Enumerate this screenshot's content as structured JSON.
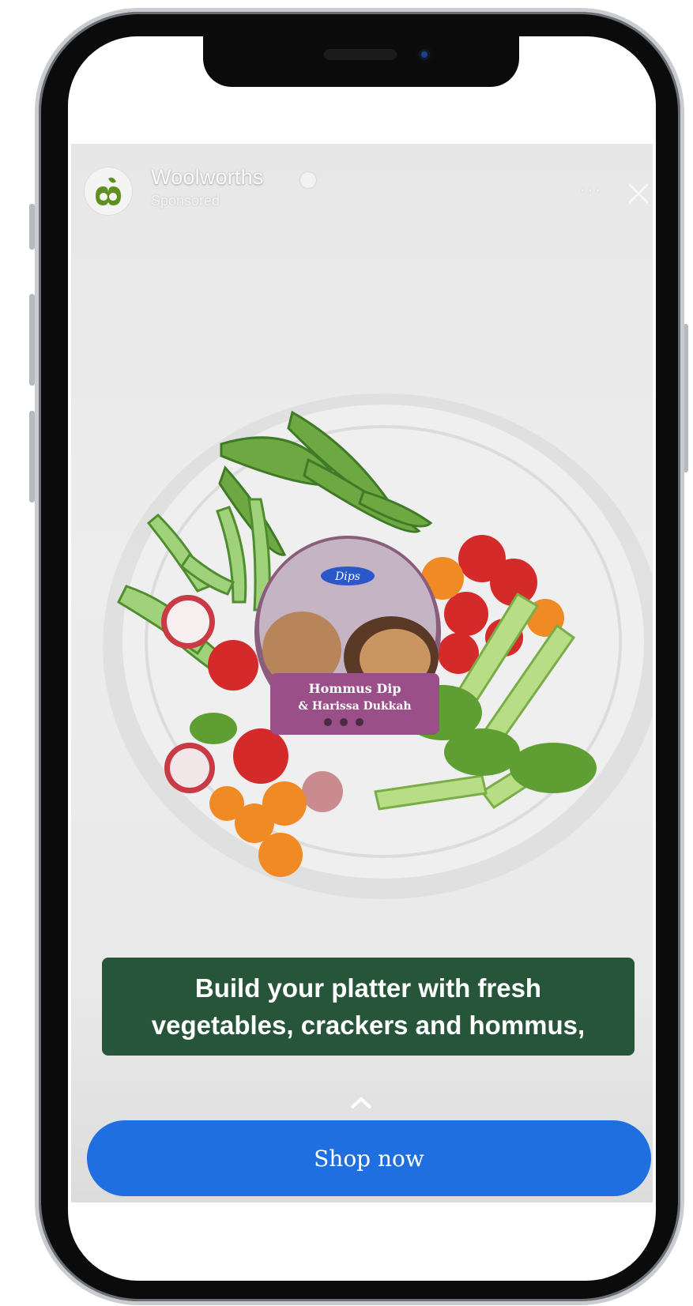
{
  "ad": {
    "brand_name": "Woolworths",
    "sponsored_label": "Sponsored",
    "more_label": "···",
    "caption": {
      "line1": "Build your platter with fresh",
      "line2": "vegetables, crackers and hommus,"
    },
    "cta_label": "Shop now"
  },
  "product": {
    "brand": "Dips",
    "name_line1": "Hommus Dip",
    "name_line2": "& Harissa Dukkah"
  },
  "icons": {
    "logo": "woolworths-logo-icon",
    "verified": "verified-badge-icon",
    "more": "more-options-icon",
    "close": "close-icon",
    "swipe": "chevron-up-icon"
  },
  "colors": {
    "caption_bg": "#27553a",
    "cta_bg": "#1f6fe0",
    "brand_green": "#5e8f21"
  }
}
